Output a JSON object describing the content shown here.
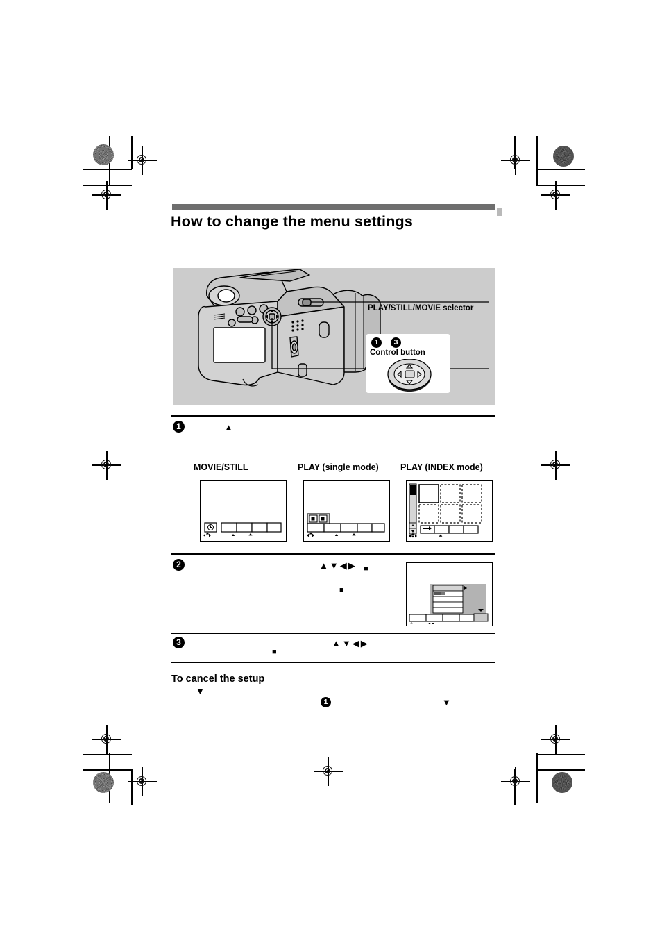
{
  "document": {
    "page_title": "How to change the menu settings",
    "section_heading": "To cancel the setup"
  },
  "figure": {
    "selector_label": "PLAY/STILL/MOVIE selector",
    "control_button_label": "Control button",
    "callout_step_markers": [
      "1",
      "3"
    ],
    "background_color": "#cccccc"
  },
  "steps": [
    {
      "number": "1",
      "text": "",
      "glyphs": [
        "▲"
      ]
    },
    {
      "number": "2",
      "text": "",
      "glyphs": [
        "▲",
        "▼",
        "◀",
        "▶",
        "■",
        "■"
      ]
    },
    {
      "number": "3",
      "text": "",
      "glyphs": [
        "■",
        "▲",
        "▼",
        "◀",
        "▶"
      ]
    }
  ],
  "cancel_section": {
    "heading": "To cancel the setup",
    "glyphs": [
      "▼",
      "1",
      "▼"
    ]
  },
  "screen_examples": [
    {
      "caption": "MOVIE/STILL",
      "mode": "movie-still"
    },
    {
      "caption": "PLAY (single mode)",
      "mode": "play-single"
    },
    {
      "caption": "PLAY (INDEX mode)",
      "mode": "play-index"
    }
  ],
  "menu_screen": {
    "rows": 5,
    "selected_row_index": 0,
    "scroll_indicator": "▼"
  },
  "colors": {
    "band": "#6e6e6e",
    "figure_bg": "#cccccc",
    "menu_gray": "#b3b3b3",
    "menu_selected": "#d4d4d4",
    "text": "#000000",
    "page_bg": "#ffffff"
  }
}
